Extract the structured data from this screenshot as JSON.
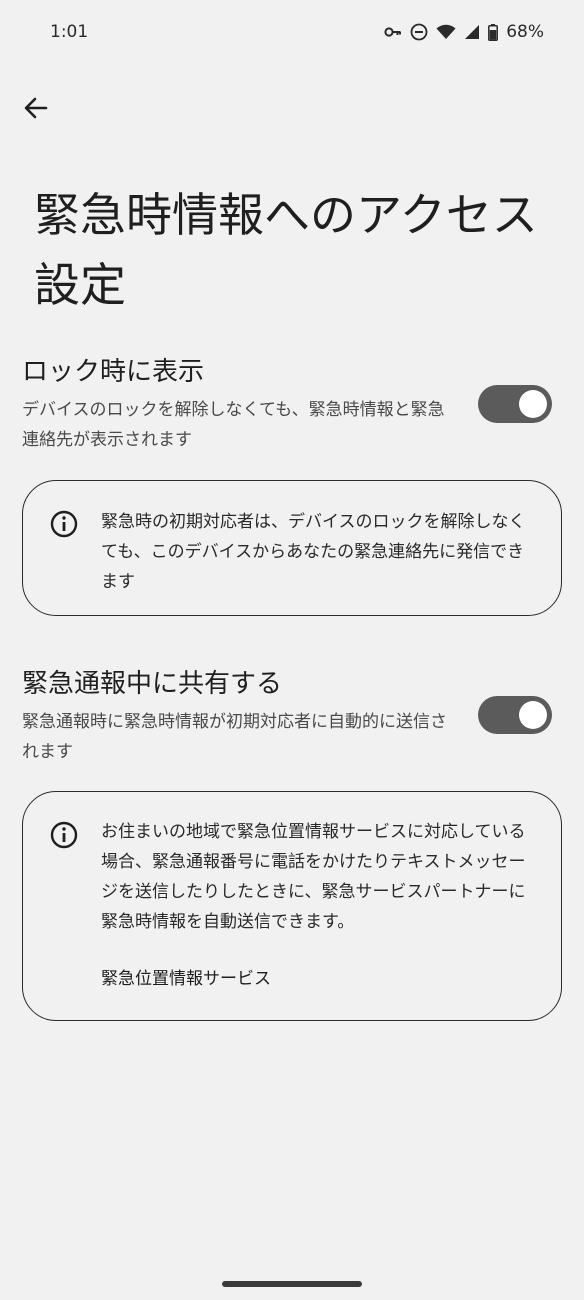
{
  "status_bar": {
    "time": "1:01",
    "battery": "68%",
    "icons": [
      "vpn-key-icon",
      "do-not-disturb-icon",
      "wifi-icon",
      "signal-icon",
      "battery-icon"
    ]
  },
  "header": {
    "back_icon": "arrow-left-icon",
    "title": "緊急時情報へのアクセス設定"
  },
  "settings": [
    {
      "title": "ロック時に表示",
      "description": "デバイスのロックを解除しなくても、緊急時情報と緊急連絡先が表示されます",
      "toggle_on": true,
      "info": {
        "icon": "info-icon",
        "text": "緊急時の初期対応者は、デバイスのロックを解除しなくても、このデバイスからあなたの緊急連絡先に発信できます"
      }
    },
    {
      "title": "緊急通報中に共有する",
      "description": "緊急通報時に緊急時情報が初期対応者に自動的に送信されます",
      "toggle_on": true,
      "info": {
        "icon": "info-icon",
        "text": "お住まいの地域で緊急位置情報サービスに対応している場合、緊急通報番号に電話をかけたりテキストメッセージを送信したりしたときに、緊急サービスパートナーに緊急時情報を自動送信できます。",
        "link": "緊急位置情報サービス"
      }
    }
  ],
  "colors": {
    "background": "#f1f1f1",
    "toggle_track": "#5b5b5b",
    "toggle_knob": "#ffffff"
  }
}
